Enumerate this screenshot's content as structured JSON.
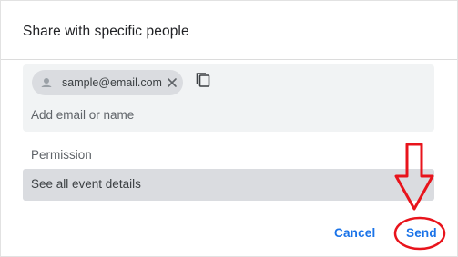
{
  "dialog": {
    "title": "Share with specific people",
    "chip": {
      "email": "sample@email.com",
      "icon": "person-icon",
      "remove_icon": "close-icon"
    },
    "copy_icon": "copy-icon",
    "add_input_placeholder": "Add email or name",
    "permission": {
      "label": "Permission",
      "value": "See all event details"
    },
    "buttons": {
      "cancel": "Cancel",
      "send": "Send"
    }
  },
  "colors": {
    "accent": "#1a73e8",
    "annotation_red": "#e8141c",
    "field_bg": "#f1f3f4",
    "chip_bg": "#dadce0"
  }
}
